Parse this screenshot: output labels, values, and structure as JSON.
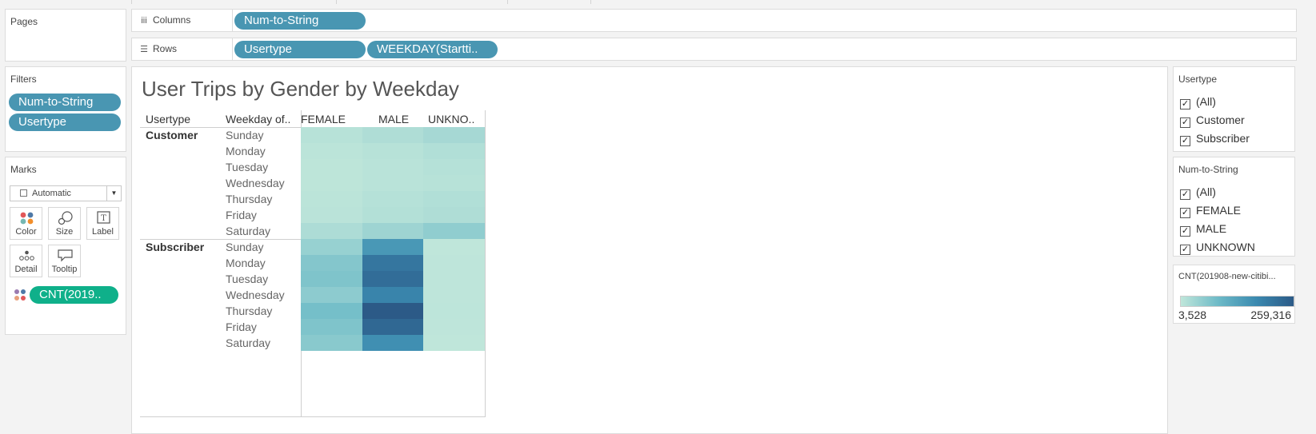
{
  "shelves": {
    "pages_label": "Pages",
    "columns_label": "Columns",
    "rows_label": "Rows",
    "columns_pills": [
      "Num-to-String"
    ],
    "rows_pills": [
      "Usertype",
      "WEEKDAY(Startti.."
    ]
  },
  "filters": {
    "title": "Filters",
    "pills": [
      "Num-to-String",
      "Usertype"
    ]
  },
  "marks": {
    "title": "Marks",
    "type_value": "Automatic",
    "buttons": [
      "Color",
      "Size",
      "Label",
      "Detail",
      "Tooltip"
    ],
    "field_pill": "CNT(2019.."
  },
  "view": {
    "title": "User Trips by Gender by Weekday",
    "headers": {
      "usertype": "Usertype",
      "weekday": "Weekday of..",
      "cols": [
        "FEMALE",
        "MALE",
        "UNKNO.."
      ]
    },
    "groups": [
      "Customer",
      "Subscriber"
    ],
    "days": [
      "Sunday",
      "Monday",
      "Tuesday",
      "Wednesday",
      "Thursday",
      "Friday",
      "Saturday"
    ]
  },
  "usertype_filter": {
    "title": "Usertype",
    "items": [
      "(All)",
      "Customer",
      "Subscriber"
    ]
  },
  "gender_filter": {
    "title": "Num-to-String",
    "items": [
      "(All)",
      "FEMALE",
      "MALE",
      "UNKNOWN"
    ]
  },
  "legend": {
    "title": "CNT(201908-new-citibi...",
    "min_label": "3,528",
    "max_label": "259,316"
  },
  "colors": {
    "pill": "#4996b2",
    "pill_green": "#0fb08a",
    "heat_low": "#bfe6da",
    "heat_high": "#2c5a87"
  },
  "chart_data": {
    "type": "heatmap",
    "title": "User Trips by Gender by Weekday",
    "columns": [
      "FEMALE",
      "MALE",
      "UNKNO.."
    ],
    "rows": [
      {
        "usertype": "Customer",
        "day": "Sunday",
        "values": [
          12000,
          20000,
          30000
        ]
      },
      {
        "usertype": "Customer",
        "day": "Monday",
        "values": [
          8000,
          12000,
          18000
        ]
      },
      {
        "usertype": "Customer",
        "day": "Tuesday",
        "values": [
          6000,
          10000,
          14000
        ]
      },
      {
        "usertype": "Customer",
        "day": "Wednesday",
        "values": [
          6000,
          10000,
          12000
        ]
      },
      {
        "usertype": "Customer",
        "day": "Thursday",
        "values": [
          8000,
          14000,
          18000
        ]
      },
      {
        "usertype": "Customer",
        "day": "Friday",
        "values": [
          9000,
          16000,
          20000
        ]
      },
      {
        "usertype": "Customer",
        "day": "Saturday",
        "values": [
          22000,
          38000,
          52000
        ]
      },
      {
        "usertype": "Subscriber",
        "day": "Sunday",
        "values": [
          45000,
          150000,
          3528
        ]
      },
      {
        "usertype": "Subscriber",
        "day": "Monday",
        "values": [
          65000,
          210000,
          5000
        ]
      },
      {
        "usertype": "Subscriber",
        "day": "Tuesday",
        "values": [
          70000,
          225000,
          5000
        ]
      },
      {
        "usertype": "Subscriber",
        "day": "Wednesday",
        "values": [
          55000,
          185000,
          4500
        ]
      },
      {
        "usertype": "Subscriber",
        "day": "Thursday",
        "values": [
          80000,
          259316,
          5500
        ]
      },
      {
        "usertype": "Subscriber",
        "day": "Friday",
        "values": [
          70000,
          235000,
          5000
        ]
      },
      {
        "usertype": "Subscriber",
        "day": "Saturday",
        "values": [
          60000,
          165000,
          4000
        ]
      }
    ],
    "color_range": [
      3528,
      259316
    ]
  }
}
